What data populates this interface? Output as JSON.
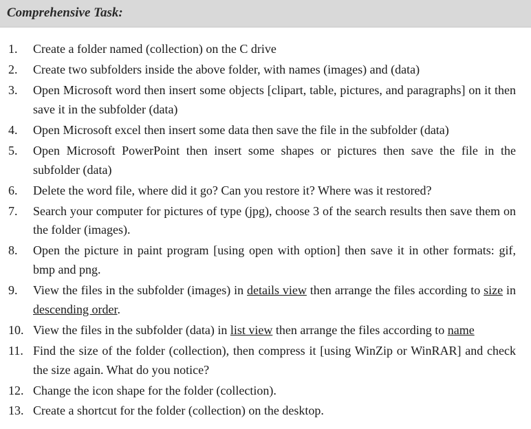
{
  "header": {
    "title": "Comprehensive Task:"
  },
  "tasks": [
    {
      "pre": "Create a folder named (collection) on the C drive"
    },
    {
      "pre": "Create two subfolders inside the above folder, with names (images) and (data)"
    },
    {
      "pre": "Open Microsoft word then insert some objects [clipart, table, pictures, and paragraphs] on it then save it in the subfolder (data)"
    },
    {
      "pre": "Open Microsoft excel then insert some data then save the file in the subfolder (data)"
    },
    {
      "pre": "Open Microsoft PowerPoint then insert some shapes or pictures then save the file in the subfolder (data)"
    },
    {
      "pre": "Delete the word file, where did it go? Can you restore it? Where was it restored?"
    },
    {
      "pre": "Search your computer for pictures of type (jpg), choose 3 of the search results then save them on the folder (images)."
    },
    {
      "pre": "Open the picture in paint program [using open with option] then save it in other formats: gif, bmp and png."
    },
    {
      "pre": "View the files in the subfolder (images) in ",
      "u1": "details view",
      "mid1": " then arrange the files according to ",
      "u2": "size",
      "mid2": " in ",
      "u3": "descending order",
      "post": "."
    },
    {
      "pre": "View the files in the subfolder (data) in ",
      "u1": "list view",
      "mid1": " then arrange the files according to ",
      "u2": "name",
      "post": ""
    },
    {
      "pre": "Find the size of the folder (collection), then compress it [using WinZip or WinRAR] and check the size again. What do you notice?"
    },
    {
      "pre": "Change the icon shape for the folder (collection)."
    },
    {
      "pre": "Create a shortcut for the folder (collection) on the desktop."
    }
  ]
}
